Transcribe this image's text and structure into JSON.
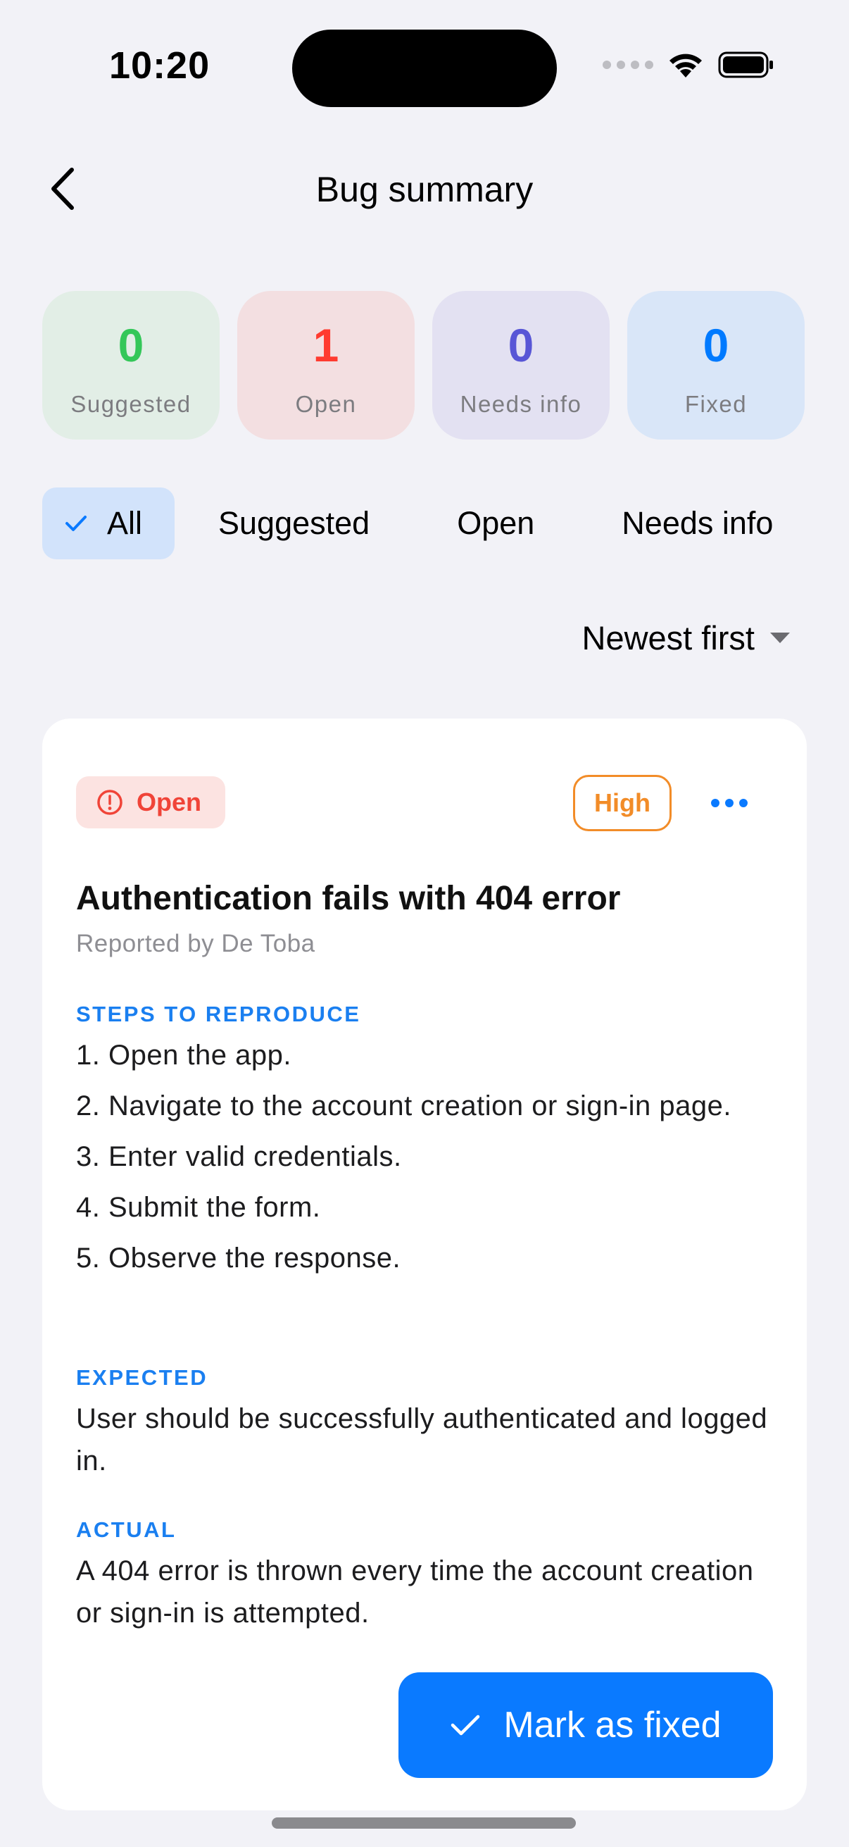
{
  "status_bar": {
    "time": "10:20"
  },
  "nav": {
    "title": "Bug summary",
    "back_icon": "chevron-left-icon"
  },
  "stats": [
    {
      "key": "suggested",
      "count": "0",
      "label": "Suggested",
      "color": "#34C759"
    },
    {
      "key": "open",
      "count": "1",
      "label": "Open",
      "color": "#FF3B30"
    },
    {
      "key": "needs",
      "count": "0",
      "label": "Needs info",
      "color": "#5856D6"
    },
    {
      "key": "fixed",
      "count": "0",
      "label": "Fixed",
      "color": "#007AFF"
    }
  ],
  "filters": {
    "items": [
      "All",
      "Suggested",
      "Open",
      "Needs info"
    ],
    "selected": "All"
  },
  "sort": {
    "label": "Newest first"
  },
  "bug": {
    "status": "Open",
    "priority": "High",
    "title": "Authentication fails with 404 error",
    "reporter": "Reported by De Toba",
    "steps_label": "STEPS TO REPRODUCE",
    "steps": [
      "1. Open the app.",
      "2. Navigate to the account creation or sign-in page.",
      "3. Enter valid credentials.",
      "4. Submit the form.",
      "5. Observe the response."
    ],
    "expected_label": "EXPECTED",
    "expected": "User should be successfully authenticated and logged in.",
    "actual_label": "ACTUAL",
    "actual": "A 404 error is thrown every time the account creation or sign-in is attempted.",
    "action_label": "Mark as fixed"
  },
  "colors": {
    "accent": "#0A7AFF",
    "open_red": "#F04438",
    "high_orange": "#F28C28",
    "background": "#F2F2F7"
  }
}
